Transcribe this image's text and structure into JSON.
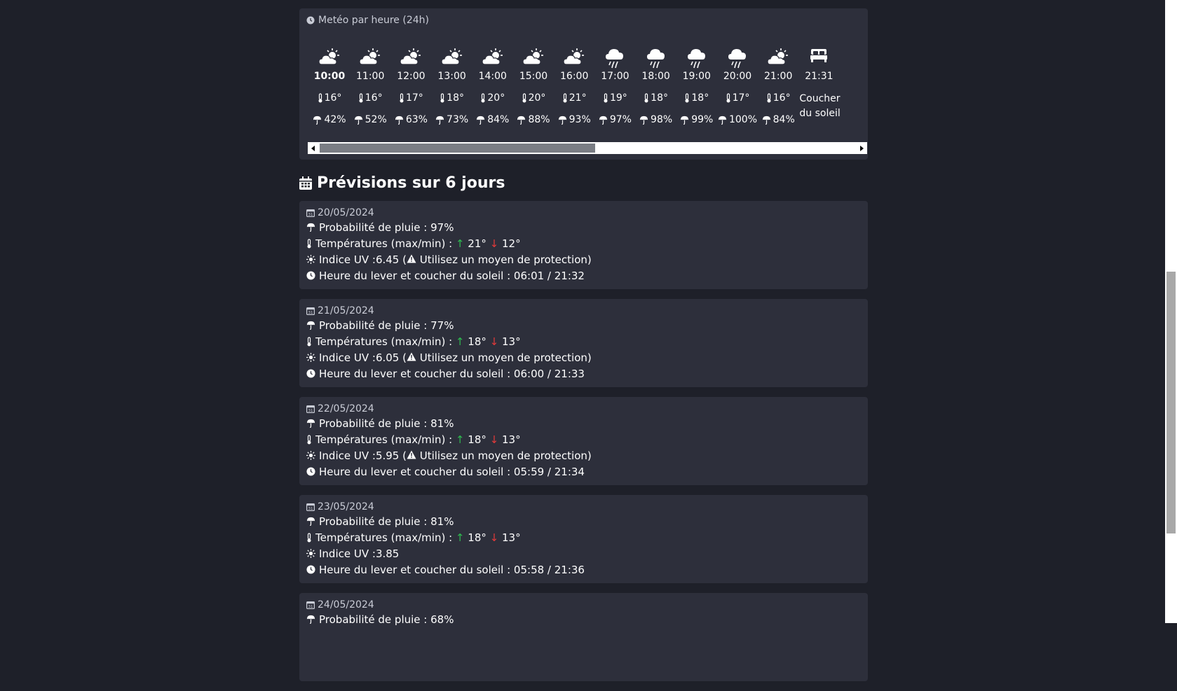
{
  "hourly": {
    "title": "Metéo par heure (24h)",
    "hours": [
      {
        "time": "10:00",
        "temp": "16°",
        "rain": "42%",
        "icon": "partly-cloudy-icon",
        "current": true
      },
      {
        "time": "11:00",
        "temp": "16°",
        "rain": "52%",
        "icon": "partly-cloudy-icon"
      },
      {
        "time": "12:00",
        "temp": "17°",
        "rain": "63%",
        "icon": "partly-cloudy-icon"
      },
      {
        "time": "13:00",
        "temp": "18°",
        "rain": "73%",
        "icon": "partly-cloudy-icon"
      },
      {
        "time": "14:00",
        "temp": "20°",
        "rain": "84%",
        "icon": "partly-cloudy-icon"
      },
      {
        "time": "15:00",
        "temp": "20°",
        "rain": "88%",
        "icon": "partly-cloudy-icon"
      },
      {
        "time": "16:00",
        "temp": "21°",
        "rain": "93%",
        "icon": "partly-cloudy-icon"
      },
      {
        "time": "17:00",
        "temp": "19°",
        "rain": "97%",
        "icon": "rain-cloud-icon"
      },
      {
        "time": "18:00",
        "temp": "18°",
        "rain": "98%",
        "icon": "rain-cloud-icon"
      },
      {
        "time": "19:00",
        "temp": "18°",
        "rain": "99%",
        "icon": "rain-cloud-icon"
      },
      {
        "time": "20:00",
        "temp": "17°",
        "rain": "100%",
        "icon": "rain-cloud-icon"
      },
      {
        "time": "21:00",
        "temp": "16°",
        "rain": "84%",
        "icon": "partly-cloudy-icon"
      }
    ],
    "sunset": {
      "time": "21:31",
      "label_line1": "Coucher",
      "label_line2": "du soleil",
      "icon": "bed-icon"
    }
  },
  "forecast": {
    "title": "Prévisions sur 6 jours",
    "rain_label": "Probabilité de pluie : ",
    "temp_label": "Températures (max/min) : ",
    "uv_label": "Indice UV : ",
    "sun_label": "Heure du lever et coucher du soleil : ",
    "days": [
      {
        "date": "20/05/2024",
        "rain": "97%",
        "max": "21°",
        "min": "12°",
        "uv": "6.45",
        "uv_warning": " Utilisez un moyen de protection)",
        "uv_open": " (",
        "sun": "06:01 / 21:32"
      },
      {
        "date": "21/05/2024",
        "rain": "77%",
        "max": "18°",
        "min": "13°",
        "uv": "6.05",
        "uv_warning": " Utilisez un moyen de protection)",
        "uv_open": " (",
        "sun": "06:00 / 21:33"
      },
      {
        "date": "22/05/2024",
        "rain": "81%",
        "max": "18°",
        "min": "13°",
        "uv": "5.95",
        "uv_warning": " Utilisez un moyen de protection)",
        "uv_open": " (",
        "sun": "05:59 / 21:34"
      },
      {
        "date": "23/05/2024",
        "rain": "81%",
        "max": "18°",
        "min": "13°",
        "uv": "3.85",
        "sun": "05:58 / 21:36"
      },
      {
        "date": "24/05/2024",
        "rain": "68%"
      }
    ]
  },
  "colors": {
    "background": "#1e2029",
    "card": "#2d2f3b",
    "up": "#2eb84f",
    "down": "#e23a3a"
  }
}
